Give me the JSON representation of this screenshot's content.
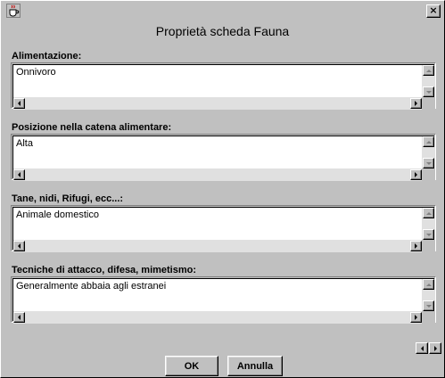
{
  "window": {
    "close_label": "×"
  },
  "dialog": {
    "title": "Proprietà scheda Fauna"
  },
  "sections": [
    {
      "label": "Alimentazione:",
      "value": "Onnivoro"
    },
    {
      "label": "Posizione nella catena alimentare:",
      "value": "Alta"
    },
    {
      "label": "Tane, nidi, Rifugi, ecc...:",
      "value": "Animale domestico"
    },
    {
      "label": "Tecniche di attacco, difesa, mimetismo:",
      "value": "Generalmente abbaia agli estranei"
    }
  ],
  "buttons": {
    "ok": "OK",
    "cancel": "Annulla"
  },
  "icons": {
    "app": "java-cup-icon",
    "close": "close-icon",
    "prev": "arrow-left-icon",
    "next": "arrow-right-icon"
  }
}
